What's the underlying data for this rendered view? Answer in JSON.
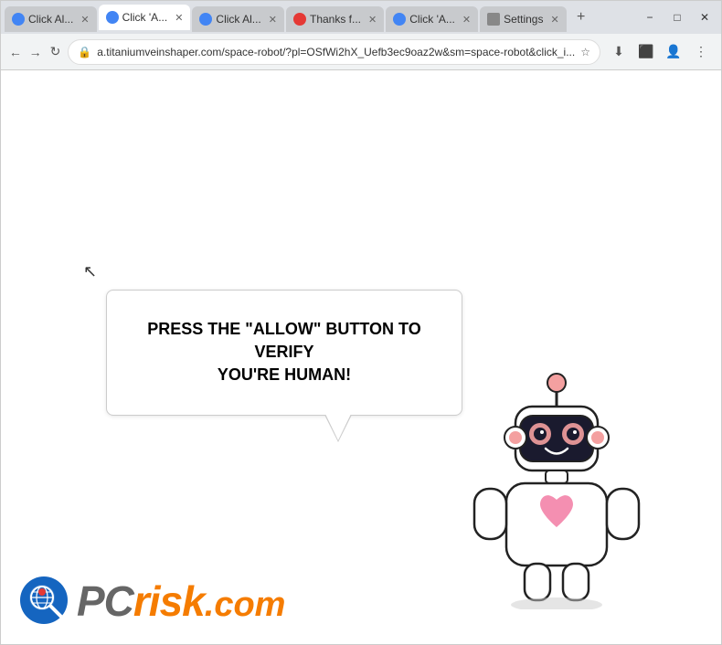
{
  "browser": {
    "tabs": [
      {
        "id": "tab1",
        "label": "Click Al...",
        "active": false,
        "favicon": "blue"
      },
      {
        "id": "tab2",
        "label": "Click 'A...",
        "active": true,
        "favicon": "blue"
      },
      {
        "id": "tab3",
        "label": "Click Al...",
        "active": false,
        "favicon": "blue"
      },
      {
        "id": "tab4",
        "label": "Thanks f...",
        "active": false,
        "favicon": "red"
      },
      {
        "id": "tab5",
        "label": "Click 'A...",
        "active": false,
        "favicon": "blue"
      },
      {
        "id": "tab6",
        "label": "Settings",
        "active": false,
        "favicon": "gear"
      }
    ],
    "url": "a.titaniumveinshaper.com/space-robot/?pl=OSfWi2hX_Uefb3ec9oaz2w&sm=space-robot&click_i...",
    "nav": {
      "back": "←",
      "forward": "→",
      "reload": "↻"
    },
    "window_controls": {
      "minimize": "−",
      "maximize": "□",
      "close": "✕"
    }
  },
  "page": {
    "bubble_line1": "PRESS THE \"ALLOW\" BUTTON TO VERIFY",
    "bubble_line2": "YOU'RE HUMAN!",
    "logo_text": "PCrisk.com"
  }
}
